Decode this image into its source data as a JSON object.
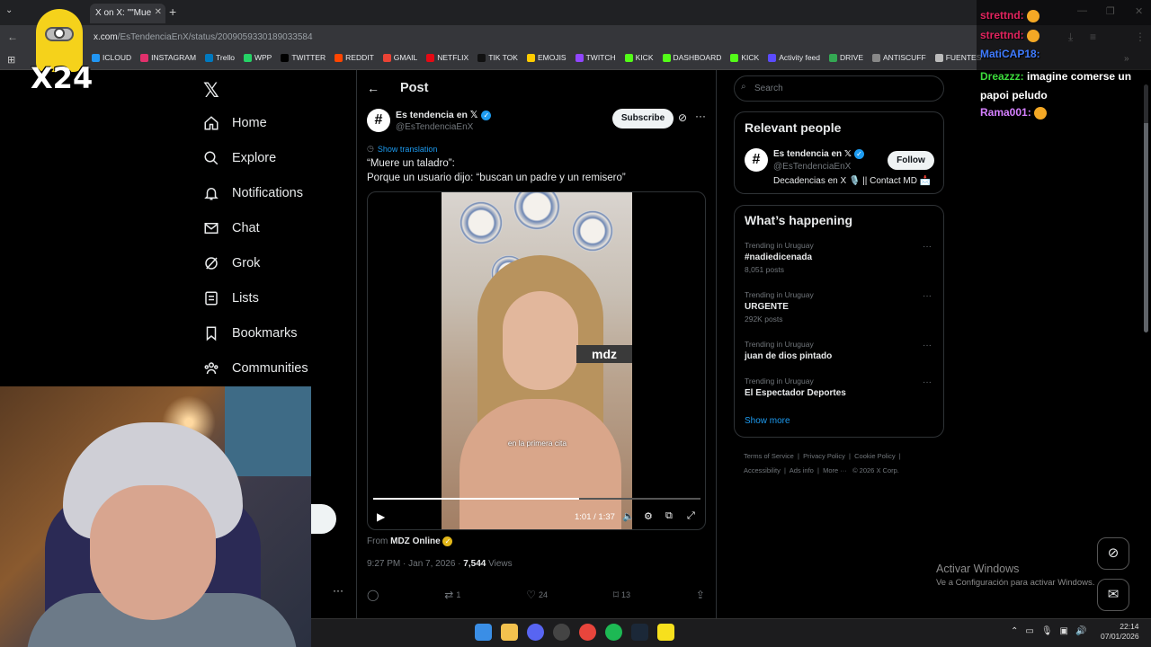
{
  "browser": {
    "tab_title": "X on X: \"\"Mue",
    "url_host": "x.com",
    "url_path": "/EsTendenciaEnX/status/2009059330189033584",
    "bookmarks": [
      {
        "label": "ICLOUD",
        "color": "#2196f3"
      },
      {
        "label": "INSTAGRAM",
        "color": "#e1306c"
      },
      {
        "label": "Trello",
        "color": "#0079bf"
      },
      {
        "label": "WPP",
        "color": "#25d366"
      },
      {
        "label": "TWITTER",
        "color": "#000000"
      },
      {
        "label": "REDDIT",
        "color": "#ff4500"
      },
      {
        "label": "GMAIL",
        "color": "#ea4335"
      },
      {
        "label": "NETFLIX",
        "color": "#e50914"
      },
      {
        "label": "TIK TOK",
        "color": "#111111"
      },
      {
        "label": "EMOJIS",
        "color": "#ffcc00"
      },
      {
        "label": "TWITCH",
        "color": "#9146ff"
      },
      {
        "label": "KICK",
        "color": "#53fc18"
      },
      {
        "label": "DASHBOARD",
        "color": "#53fc18"
      },
      {
        "label": "KICK",
        "color": "#53fc18"
      },
      {
        "label": "Activity feed",
        "color": "#5b4bff"
      },
      {
        "label": "DRIVE",
        "color": "#34a853"
      },
      {
        "label": "ANTISCUFF",
        "color": "#888888"
      },
      {
        "label": "FUENTES",
        "color": "#bbbbbb"
      }
    ]
  },
  "sidebar": {
    "items": [
      {
        "label": "Home"
      },
      {
        "label": "Explore"
      },
      {
        "label": "Notifications"
      },
      {
        "label": "Chat"
      },
      {
        "label": "Grok"
      },
      {
        "label": "Lists"
      },
      {
        "label": "Bookmarks"
      },
      {
        "label": "Communities"
      }
    ]
  },
  "post": {
    "header_title": "Post",
    "author_name": "Es tendencia en 𝕏",
    "author_handle": "@EsTendenciaEnX",
    "avatar_glyph": "#",
    "subscribe_label": "Subscribe",
    "show_translation": "Show translation",
    "text_line1": "“Muere un taladro”:",
    "text_line2": "Porque un usuario dijo: “buscan un padre y un remisero”",
    "video": {
      "watermark": "mdz",
      "caption": "en la primera cita",
      "time": "1:01 / 1:37",
      "progress": 0.63
    },
    "from_prefix": "From",
    "from_source": "MDZ Online",
    "timestamp": "9:27 PM · Jan 7, 2026 ·",
    "views_count": "7,544",
    "views_label": "Views",
    "retweets": "1",
    "likes": "24",
    "bookmarks": "13"
  },
  "right": {
    "search_placeholder": "Search",
    "relevant_title": "Relevant people",
    "rp_name": "Es tendencia en 𝕏",
    "rp_handle": "@EsTendenciaEnX",
    "rp_bio": "Decadencias en X 🎙️ || Contact MD 📩",
    "follow_label": "Follow",
    "happening_title": "What’s happening",
    "trends": [
      {
        "context": "Trending in Uruguay",
        "name": "#nadiedicenada",
        "count": "8,051 posts"
      },
      {
        "context": "Trending in Uruguay",
        "name": "URGENTE",
        "count": "292K posts"
      },
      {
        "context": "Trending in Uruguay",
        "name": "juan de dios pintado",
        "count": ""
      },
      {
        "context": "Trending in Uruguay",
        "name": "El Espectador Deportes",
        "count": ""
      }
    ],
    "show_more": "Show more",
    "footer_links": [
      "Terms of Service",
      "Privacy Policy",
      "Cookie Policy",
      "Accessibility",
      "Ads info",
      "More ···",
      "© 2026 X Corp."
    ]
  },
  "windows": {
    "activate_title": "Activar Windows",
    "activate_sub": "Ve a Configuración para activar Windows.",
    "time": "22:14",
    "date": "07/01/2026"
  },
  "chat": {
    "lines": [
      {
        "user": "strettnd:",
        "msg": "",
        "color": "#e0245e"
      },
      {
        "user": "strettnd:",
        "msg": "",
        "color": "#e0245e"
      },
      {
        "user": "MatiCAP18:",
        "msg": "",
        "color": "#3f7bff"
      },
      {
        "user": "Dreazzz:",
        "msg": "imagine comerse un papoi peludo",
        "color": "#3cdc3c"
      },
      {
        "user": "Rama001:",
        "msg": "",
        "color": "#d580ff"
      }
    ]
  },
  "overlay": {
    "badge_text": "X24"
  }
}
